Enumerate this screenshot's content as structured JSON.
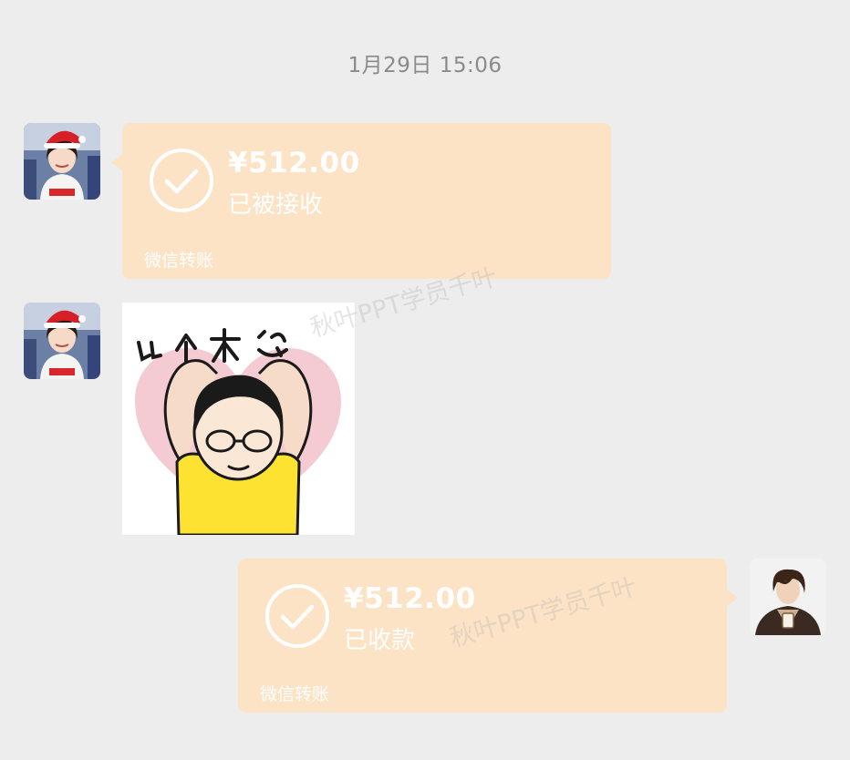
{
  "chat": {
    "timestamp": "1月29日 15:06",
    "messages": [
      {
        "sender": "contact",
        "type": "transfer",
        "amount": "¥512.00",
        "status": "已被接收",
        "label": "微信转账"
      },
      {
        "sender": "contact",
        "type": "sticker",
        "sticker_text": "比个大心",
        "sticker_icon": "heart-pose-sticker"
      },
      {
        "sender": "me",
        "type": "transfer",
        "amount": "¥512.00",
        "status": "已收款",
        "label": "微信转账"
      }
    ]
  },
  "watermark": {
    "text": "秋叶PPT学员千叶"
  },
  "colors": {
    "background": "#ededed",
    "transfer_bubble": "#fce3c5",
    "transfer_text": "#ffffff",
    "timestamp_text": "#8a8a8a"
  }
}
